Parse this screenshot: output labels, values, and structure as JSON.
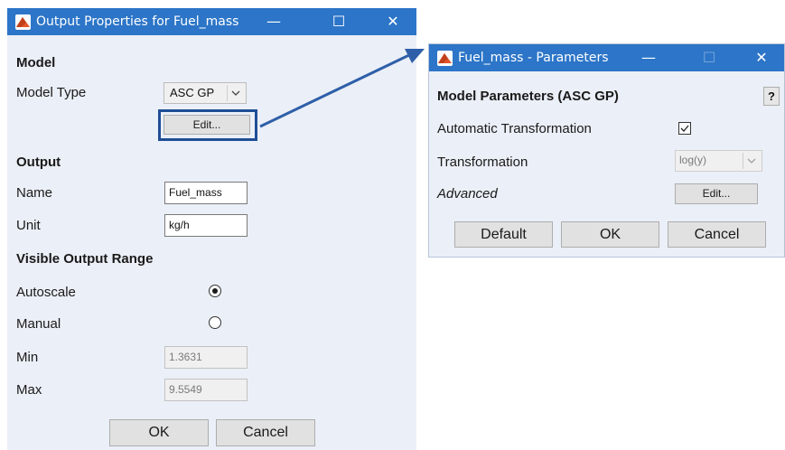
{
  "output_dialog": {
    "title": "Output Properties for Fuel_mass",
    "controls": {
      "minimize": "—",
      "maximize": "☐",
      "close": "✕"
    },
    "model_section": "Model",
    "model_type_label": "Model Type",
    "model_type_value": "ASC GP",
    "edit_button": "Edit...",
    "output_section": "Output",
    "name_label": "Name",
    "name_value": "Fuel_mass",
    "unit_label": "Unit",
    "unit_value": "kg/h",
    "range_section": "Visible Output Range",
    "autoscale_label": "Autoscale",
    "autoscale_selected": true,
    "manual_label": "Manual",
    "manual_selected": false,
    "min_label": "Min",
    "min_value": "1.3631",
    "max_label": "Max",
    "max_value": "9.5549",
    "ok_button": "OK",
    "cancel_button": "Cancel"
  },
  "params_dialog": {
    "title": "Fuel_mass - Parameters",
    "controls": {
      "minimize": "—",
      "maximize": "☐",
      "close": "✕"
    },
    "section": "Model Parameters (ASC GP)",
    "help_button": "?",
    "auto_transform_label": "Automatic Transformation",
    "auto_transform_checked": true,
    "transformation_label": "Transformation",
    "transformation_value": "log(y)",
    "advanced_label": "Advanced",
    "edit_button": "Edit...",
    "default_button": "Default",
    "ok_button": "OK",
    "cancel_button": "Cancel"
  },
  "colors": {
    "titlebar": "#2c75c8",
    "client_bg": "#ebeff7",
    "highlight": "#1f4e95",
    "arrow": "#2e5fa8"
  }
}
